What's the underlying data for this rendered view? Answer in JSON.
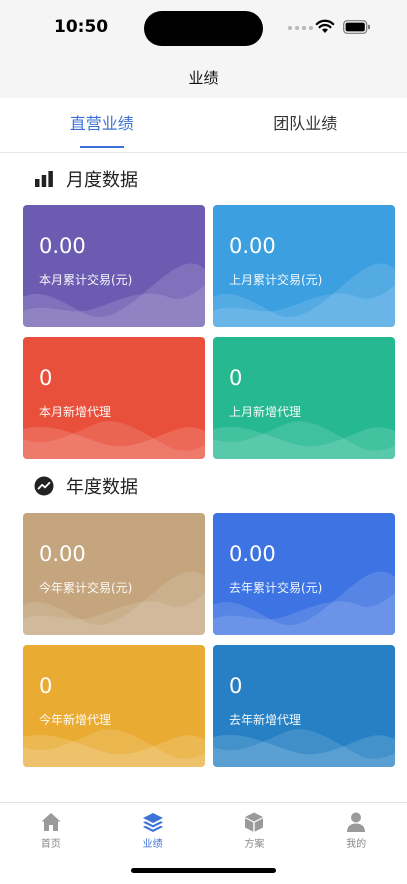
{
  "status_bar": {
    "time": "10:50"
  },
  "nav": {
    "title": "业绩"
  },
  "tabs": [
    {
      "label": "直营业绩",
      "active": true
    },
    {
      "label": "团队业绩",
      "active": false
    }
  ],
  "sections": {
    "monthly": {
      "title": "月度数据",
      "cards": [
        {
          "value": "0.00",
          "label": "本月累计交易(元)",
          "color": "#6c5cb1"
        },
        {
          "value": "0.00",
          "label": "上月累计交易(元)",
          "color": "#3b9fe0"
        },
        {
          "value": "0",
          "label": "本月新增代理",
          "color": "#e9503c"
        },
        {
          "value": "0",
          "label": "上月新增代理",
          "color": "#25b891"
        }
      ]
    },
    "yearly": {
      "title": "年度数据",
      "cards": [
        {
          "value": "0.00",
          "label": "今年累计交易(元)",
          "color": "#c4a57d"
        },
        {
          "value": "0.00",
          "label": "去年累计交易(元)",
          "color": "#3d73e2"
        },
        {
          "value": "0",
          "label": "今年新增代理",
          "color": "#e9ab32"
        },
        {
          "value": "0",
          "label": "去年新增代理",
          "color": "#2680c3"
        }
      ]
    }
  },
  "tabbar": [
    {
      "label": "首页",
      "icon": "home-icon",
      "active": false
    },
    {
      "label": "业绩",
      "icon": "layers-icon",
      "active": true
    },
    {
      "label": "方案",
      "icon": "box-icon",
      "active": false
    },
    {
      "label": "我的",
      "icon": "user-icon",
      "active": false
    }
  ],
  "colors": {
    "accent": "#3f72d8",
    "inactive": "#9a9a9a"
  }
}
